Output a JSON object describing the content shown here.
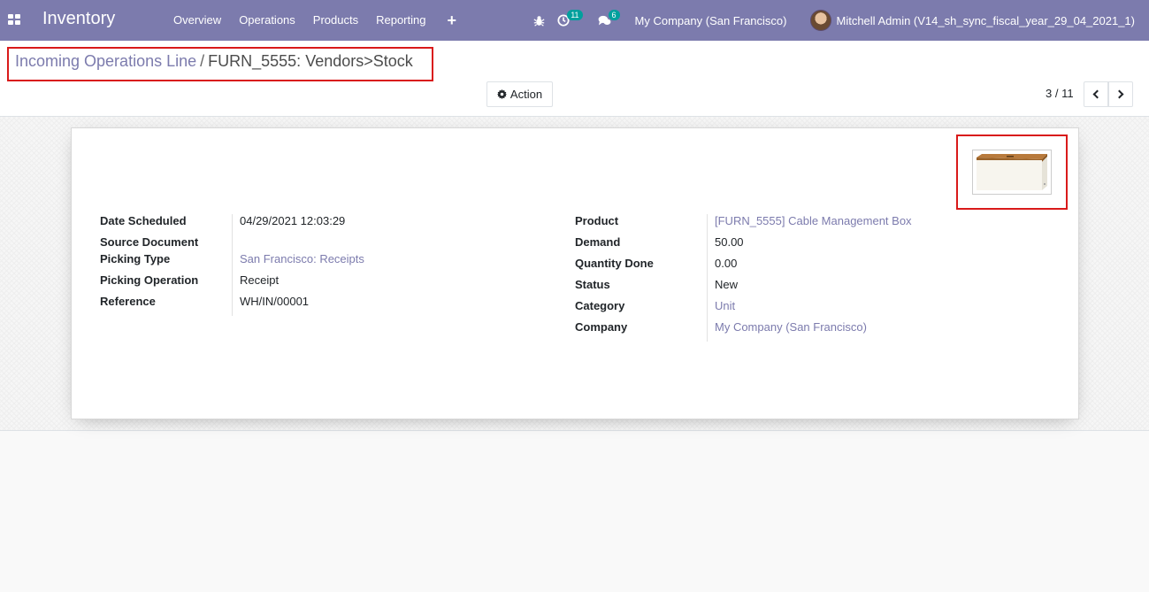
{
  "navbar": {
    "app_title": "Inventory",
    "menu": [
      "Overview",
      "Operations",
      "Products",
      "Reporting"
    ],
    "plus": "+",
    "activity_count": "11",
    "message_count": "6",
    "company": "My Company (San Francisco)",
    "user": "Mitchell Admin (V14_sh_sync_fiscal_year_29_04_2021_1)"
  },
  "control": {
    "breadcrumb_parent": "Incoming Operations Line",
    "breadcrumb_separator": "/",
    "breadcrumb_current": "FURN_5555: Vendors>Stock",
    "action_label": "Action",
    "pager": "3 / 11"
  },
  "form": {
    "left_fields": [
      {
        "label": "Date Scheduled",
        "value": "04/29/2021 12:03:29"
      },
      {
        "label": "Source Document",
        "value": ""
      },
      {
        "label": "Picking Type",
        "value": "San Francisco: Receipts"
      },
      {
        "label": "Picking Operation",
        "value": "Receipt"
      },
      {
        "label": "Reference",
        "value": "WH/IN/00001"
      }
    ],
    "right_fields": [
      {
        "label": "Product",
        "value": "[FURN_5555] Cable Management Box"
      },
      {
        "label": "Demand",
        "value": "50.00"
      },
      {
        "label": "Quantity Done",
        "value": "0.00"
      },
      {
        "label": "Status",
        "value": "New"
      },
      {
        "label": "Category",
        "value": "Unit"
      },
      {
        "label": "Company",
        "value": "My Company (San Francisco)"
      }
    ]
  },
  "colors": {
    "brand": "#7c7bad",
    "highlight": "#d91a1a",
    "badge": "#00a09d"
  }
}
